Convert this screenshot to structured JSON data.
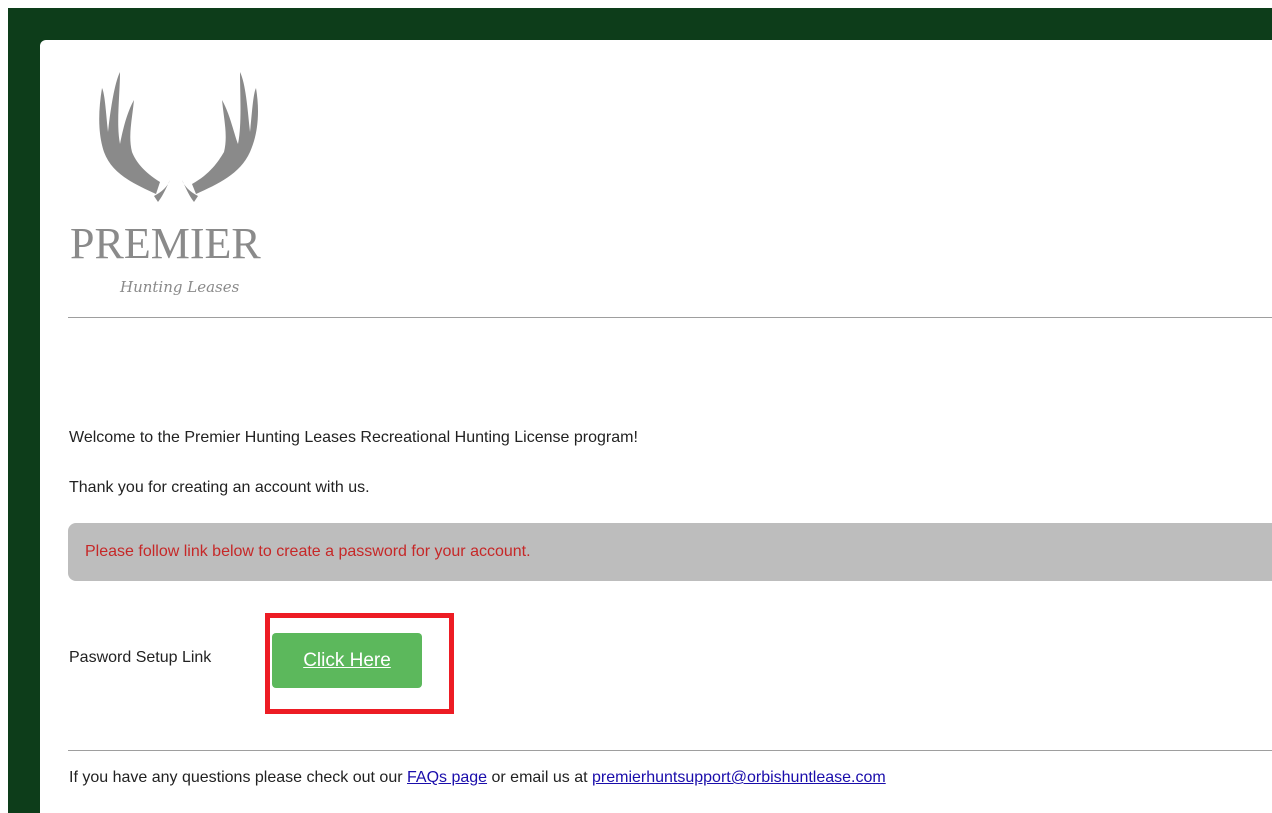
{
  "brand": {
    "name": "PREMIER",
    "tagline": "Hunting Leases"
  },
  "colors": {
    "frame": "#0d3d1a",
    "logo_gray": "#8a8a8a",
    "alert_bg": "#bdbdbd",
    "alert_text": "#c62828",
    "button": "#5cb85c",
    "highlight": "#ed1c24",
    "link": "#1a0dab"
  },
  "icons": {
    "logo": "antler-logo-icon"
  },
  "email": {
    "welcome": "Welcome to the Premier Hunting Leases Recreational Hunting License program!",
    "thanks": "Thank you for creating an account with us.",
    "alert": "Please follow link below to create a password for your account.",
    "setup_label": "Pasword Setup Link",
    "button_label": "Click Here",
    "footer": {
      "prefix": "If you have any questions please check out our ",
      "faq_link": "FAQs page",
      "middle": " or email us at ",
      "email_link": "premierhuntsupport@orbishuntlease.com"
    }
  }
}
